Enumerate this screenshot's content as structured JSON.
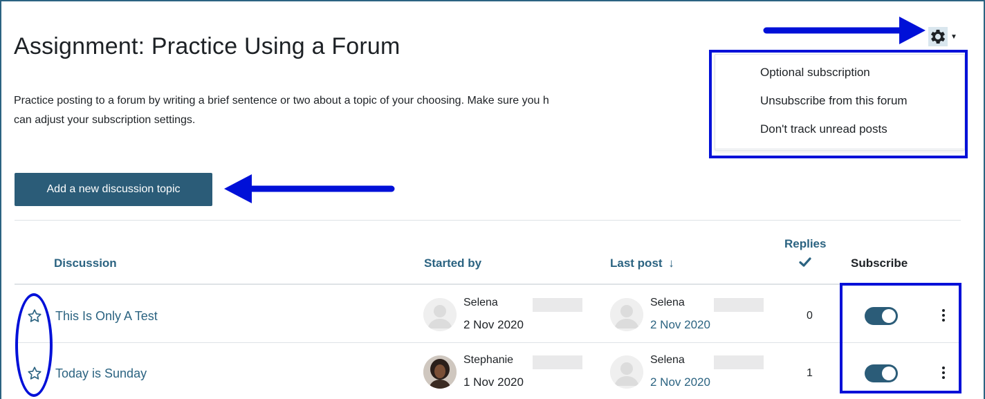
{
  "page": {
    "title": "Assignment: Practice Using a Forum",
    "intro_line1": "Practice posting to a forum by writing a brief sentence or two about a topic of your choosing. Make sure you h",
    "intro_line2": "can adjust your subscription settings."
  },
  "settings_menu": {
    "icon": "gear-icon",
    "items": [
      {
        "label": "Optional subscription"
      },
      {
        "label": "Unsubscribe from this forum"
      },
      {
        "label": "Don't track unread posts"
      }
    ]
  },
  "actions": {
    "add_topic_label": "Add a new discussion topic"
  },
  "table": {
    "headers": {
      "discussion": "Discussion",
      "started_by": "Started by",
      "last_post": "Last post",
      "last_post_sort": "↓",
      "replies": "Replies",
      "subscribe": "Subscribe"
    },
    "rows": [
      {
        "starred": false,
        "topic": "This Is Only A Test",
        "started_by": {
          "name": "Selena",
          "date": "2 Nov 2020"
        },
        "last_post": {
          "name": "Selena",
          "date": "2 Nov 2020"
        },
        "replies": "0",
        "subscribed": true
      },
      {
        "starred": false,
        "topic": "Today is Sunday",
        "started_by": {
          "name": "Stephanie",
          "date": "1 Nov 2020"
        },
        "last_post": {
          "name": "Selena",
          "date": "2 Nov 2020"
        },
        "replies": "1",
        "subscribed": true
      }
    ]
  },
  "colors": {
    "brand": "#2b5c78",
    "link": "#2b6381",
    "annotation": "#0010d8"
  }
}
